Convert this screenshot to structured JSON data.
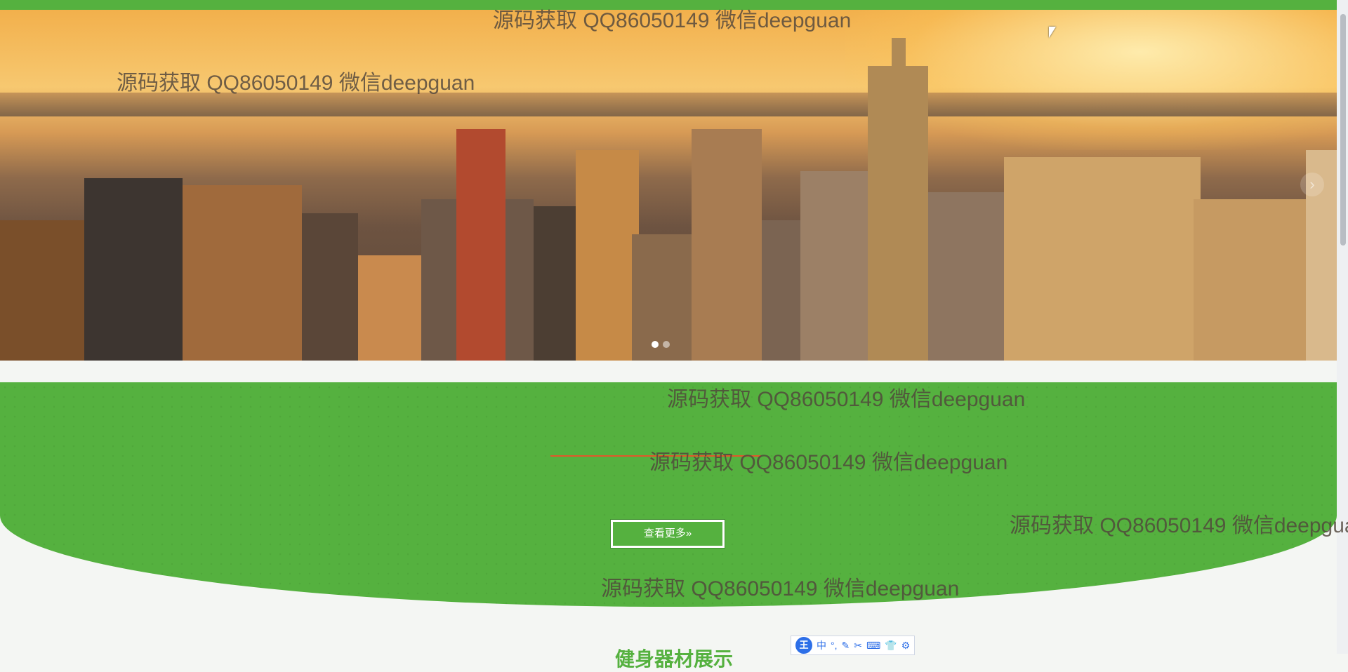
{
  "watermark_text": "源码获取 QQ86050149 微信deepguan",
  "banner": {
    "next_arrow": "›",
    "slides": 2,
    "active_slide": 1
  },
  "green_section": {
    "title": "",
    "more_button_label": "查看更多»"
  },
  "products_section": {
    "title": "健身器材展示"
  },
  "ime_toolbar": {
    "logo": "王",
    "items": [
      "中",
      "°,",
      "✎",
      "✂",
      "⌨",
      "👕",
      "⚙"
    ]
  },
  "colors": {
    "brand_green": "#55b13f",
    "accent_red": "#e2572a"
  }
}
